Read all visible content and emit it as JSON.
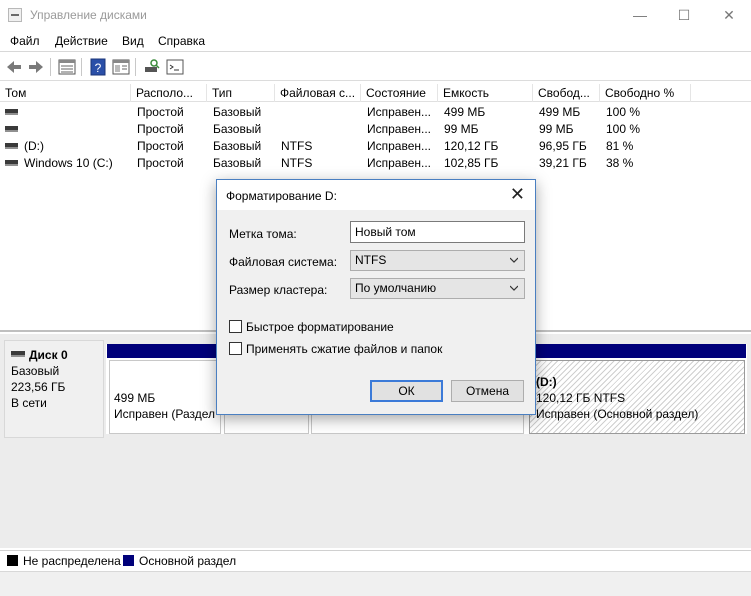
{
  "window": {
    "title": "Управление дисками",
    "minimize_glyph": "—",
    "maximize_glyph": "☐",
    "close_glyph": "✕"
  },
  "menu": {
    "items": [
      "Файл",
      "Действие",
      "Вид",
      "Справка"
    ]
  },
  "toolbar": {
    "icons": [
      "back-arrow-icon",
      "forward-arrow-icon",
      "volume-list-icon",
      "help-icon",
      "properties-icon",
      "rescan-icon",
      "console-icon"
    ]
  },
  "volume_table": {
    "columns": [
      "Том",
      "Располо...",
      "Тип",
      "Файловая с...",
      "Состояние",
      "Емкость",
      "Свобод...",
      "Свободно %"
    ],
    "rows": [
      [
        "",
        "Простой",
        "Базовый",
        "",
        "Исправен...",
        "499 МБ",
        "499 МБ",
        "100 %"
      ],
      [
        "",
        "Простой",
        "Базовый",
        "",
        "Исправен...",
        "99 МБ",
        "99 МБ",
        "100 %"
      ],
      [
        "(D:)",
        "Простой",
        "Базовый",
        "NTFS",
        "Исправен...",
        "120,12 ГБ",
        "96,95 ГБ",
        "81 %"
      ],
      [
        "Windows 10 (C:)",
        "Простой",
        "Базовый",
        "NTFS",
        "Исправен...",
        "102,85 ГБ",
        "39,21 ГБ",
        "38 %"
      ]
    ]
  },
  "disk": {
    "name": "Диск 0",
    "type": "Базовый",
    "size": "223,56 ГБ",
    "status": "В сети",
    "partitions": {
      "p1_size": "499 МБ",
      "p1_status": "Исправен (Раздел",
      "d_label": "(D:)",
      "d_size": "120,12 ГБ NTFS",
      "d_status": "Исправен (Основной раздел)"
    }
  },
  "legend": {
    "unallocated": "Не распределена",
    "unallocated_color": "#000000",
    "primary": "Основной раздел",
    "primary_color": "#00007a"
  },
  "dialog": {
    "title": "Форматирование D:",
    "close_glyph": "✕",
    "volume_label_label": "Метка тома:",
    "volume_label_value": "Новый том",
    "fs_label": "Файловая система:",
    "fs_value": "NTFS",
    "cluster_label": "Размер кластера:",
    "cluster_value": "По умолчанию",
    "quick_format_label": "Быстрое форматирование",
    "quick_format_checked": false,
    "compression_label": "Применять сжатие файлов и папок",
    "compression_checked": false,
    "ok_label": "ОК",
    "cancel_label": "Отмена",
    "ok_border_color": "#3b7ad8"
  }
}
